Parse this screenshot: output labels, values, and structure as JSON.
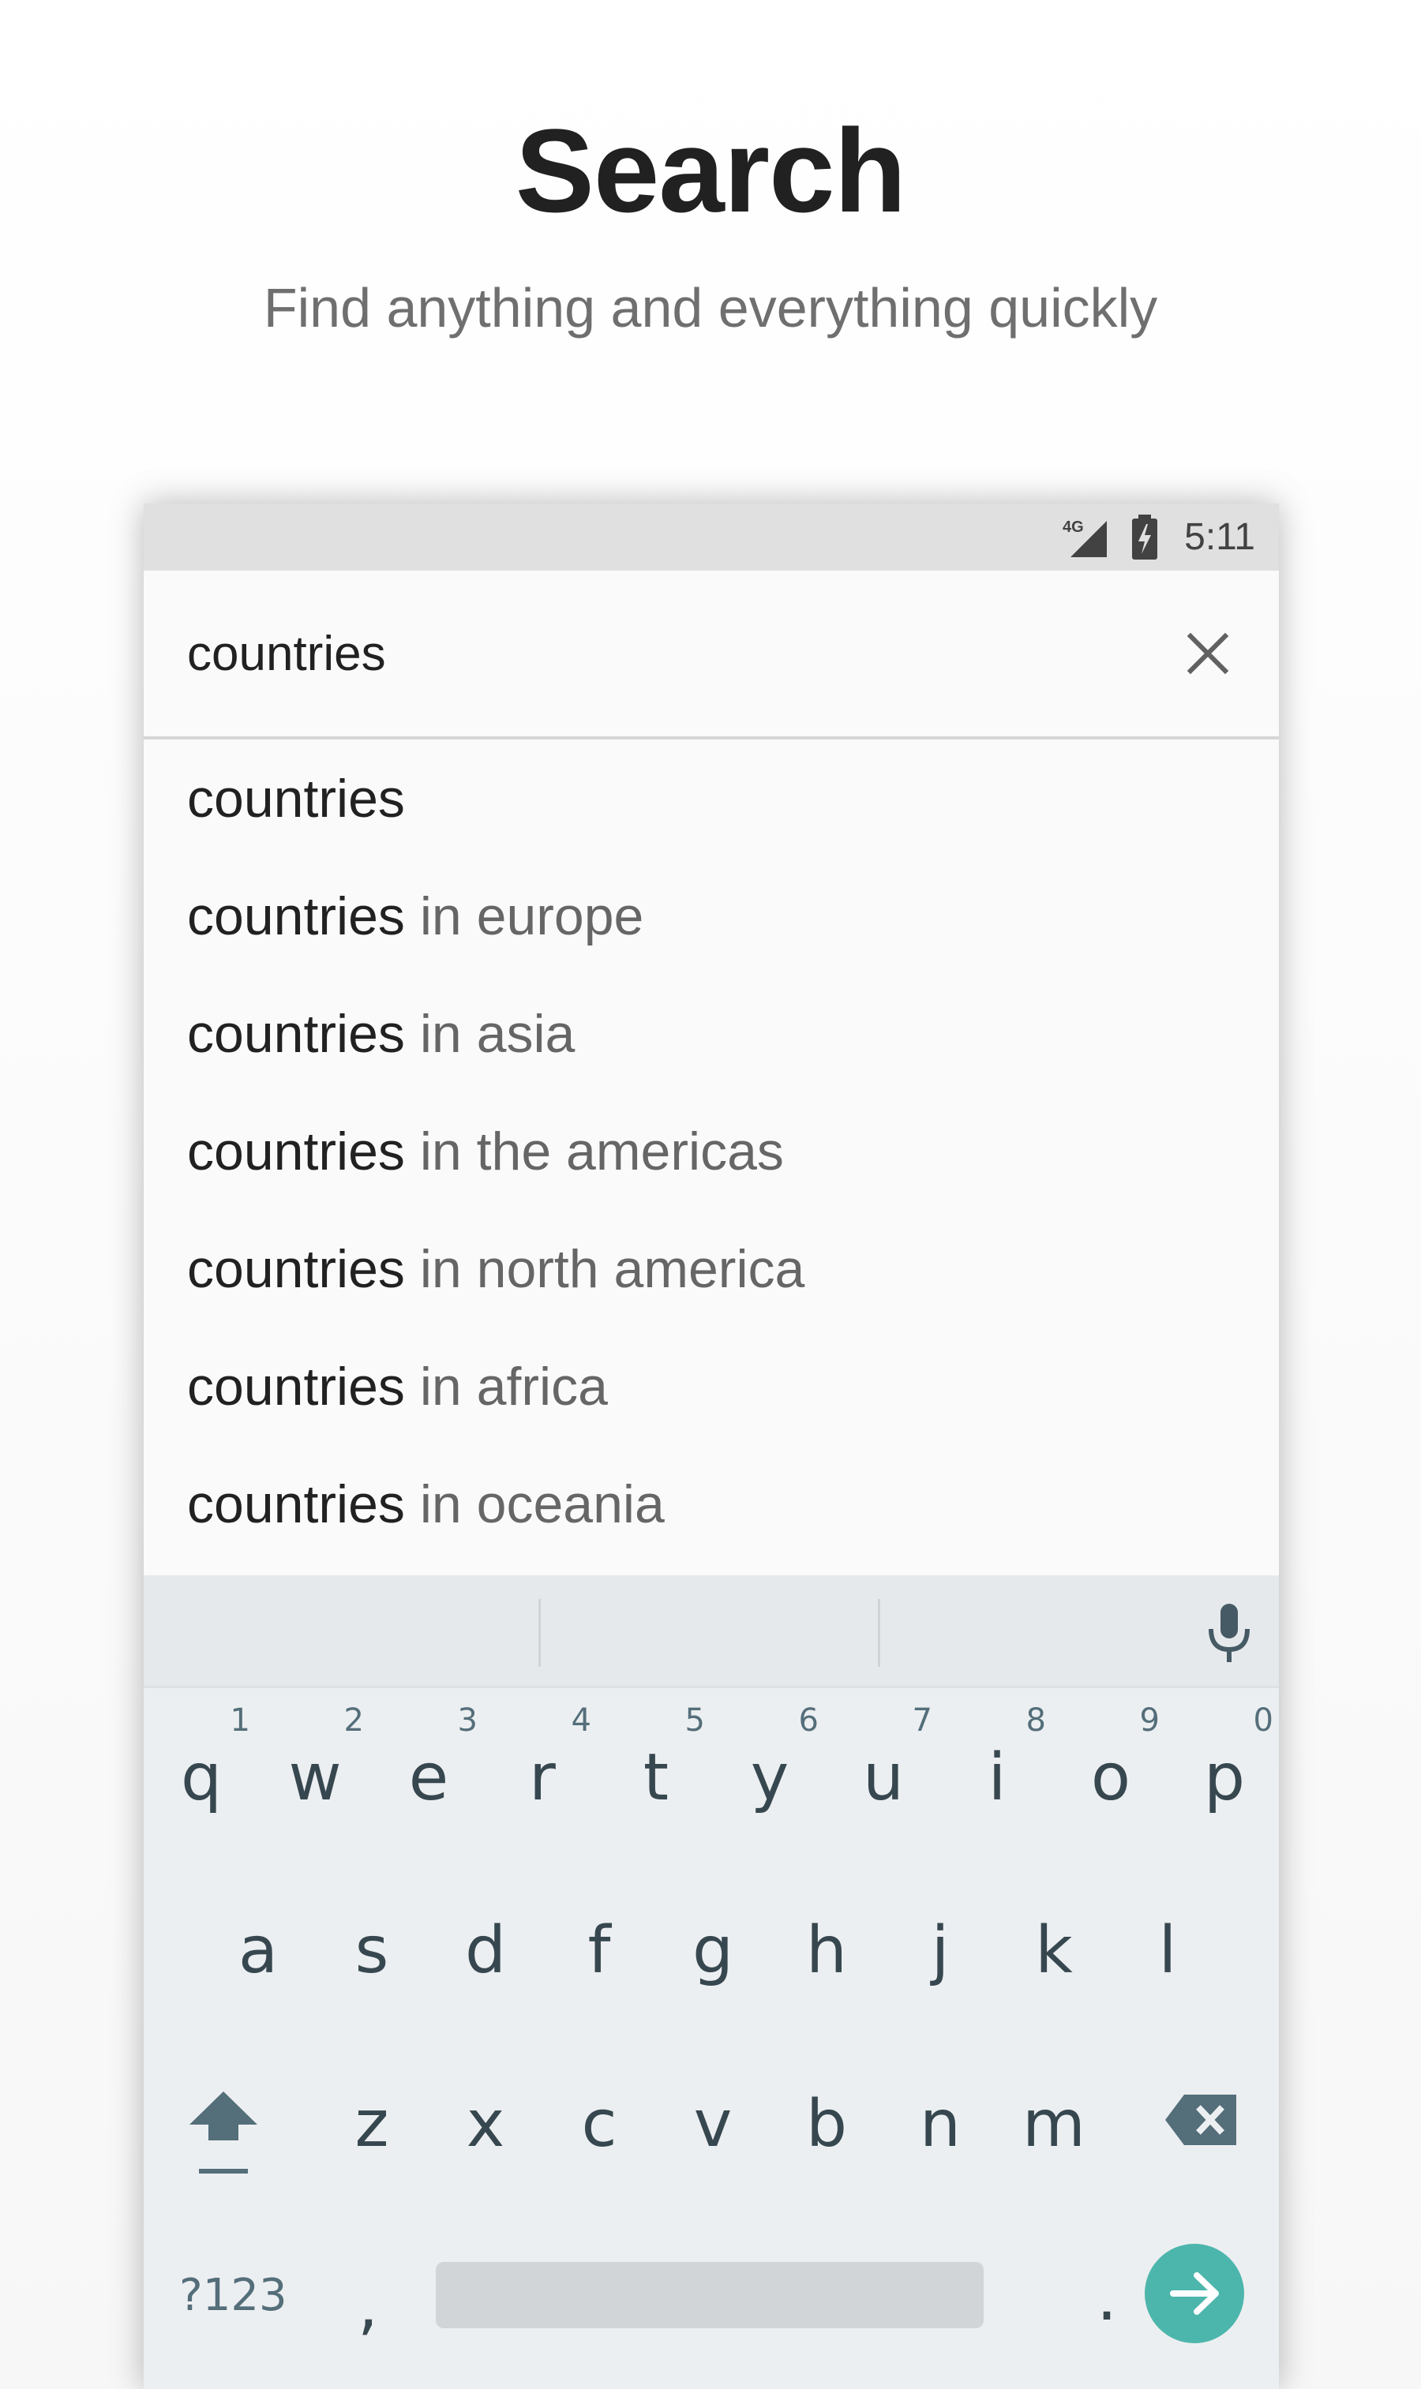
{
  "promo": {
    "title": "Search",
    "subtitle": "Find anything and everything quickly"
  },
  "status_bar": {
    "network": "4G",
    "time": "5:11",
    "icons": [
      "signal-icon",
      "battery-charging-icon"
    ]
  },
  "search": {
    "value": "countries",
    "clear_icon": "close-icon"
  },
  "suggestions": [
    {
      "query": "countries",
      "rest": ""
    },
    {
      "query": "countries",
      "rest": " in europe"
    },
    {
      "query": "countries",
      "rest": " in asia"
    },
    {
      "query": "countries",
      "rest": " in the americas"
    },
    {
      "query": "countries",
      "rest": " in north america"
    },
    {
      "query": "countries",
      "rest": " in africa"
    },
    {
      "query": "countries",
      "rest": " in oceania"
    }
  ],
  "keyboard": {
    "row1": [
      {
        "k": "q",
        "n": "1"
      },
      {
        "k": "w",
        "n": "2"
      },
      {
        "k": "e",
        "n": "3"
      },
      {
        "k": "r",
        "n": "4"
      },
      {
        "k": "t",
        "n": "5"
      },
      {
        "k": "y",
        "n": "6"
      },
      {
        "k": "u",
        "n": "7"
      },
      {
        "k": "i",
        "n": "8"
      },
      {
        "k": "o",
        "n": "9"
      },
      {
        "k": "p",
        "n": "0"
      }
    ],
    "row2": [
      "a",
      "s",
      "d",
      "f",
      "g",
      "h",
      "j",
      "k",
      "l"
    ],
    "row3": [
      "z",
      "x",
      "c",
      "v",
      "b",
      "n",
      "m"
    ],
    "symbols_label": "?123",
    "comma": ",",
    "period": ".",
    "accent_color": "#4db6ac",
    "icons": [
      "mic-icon",
      "shift-icon",
      "backspace-icon",
      "arrow-right-icon"
    ]
  }
}
